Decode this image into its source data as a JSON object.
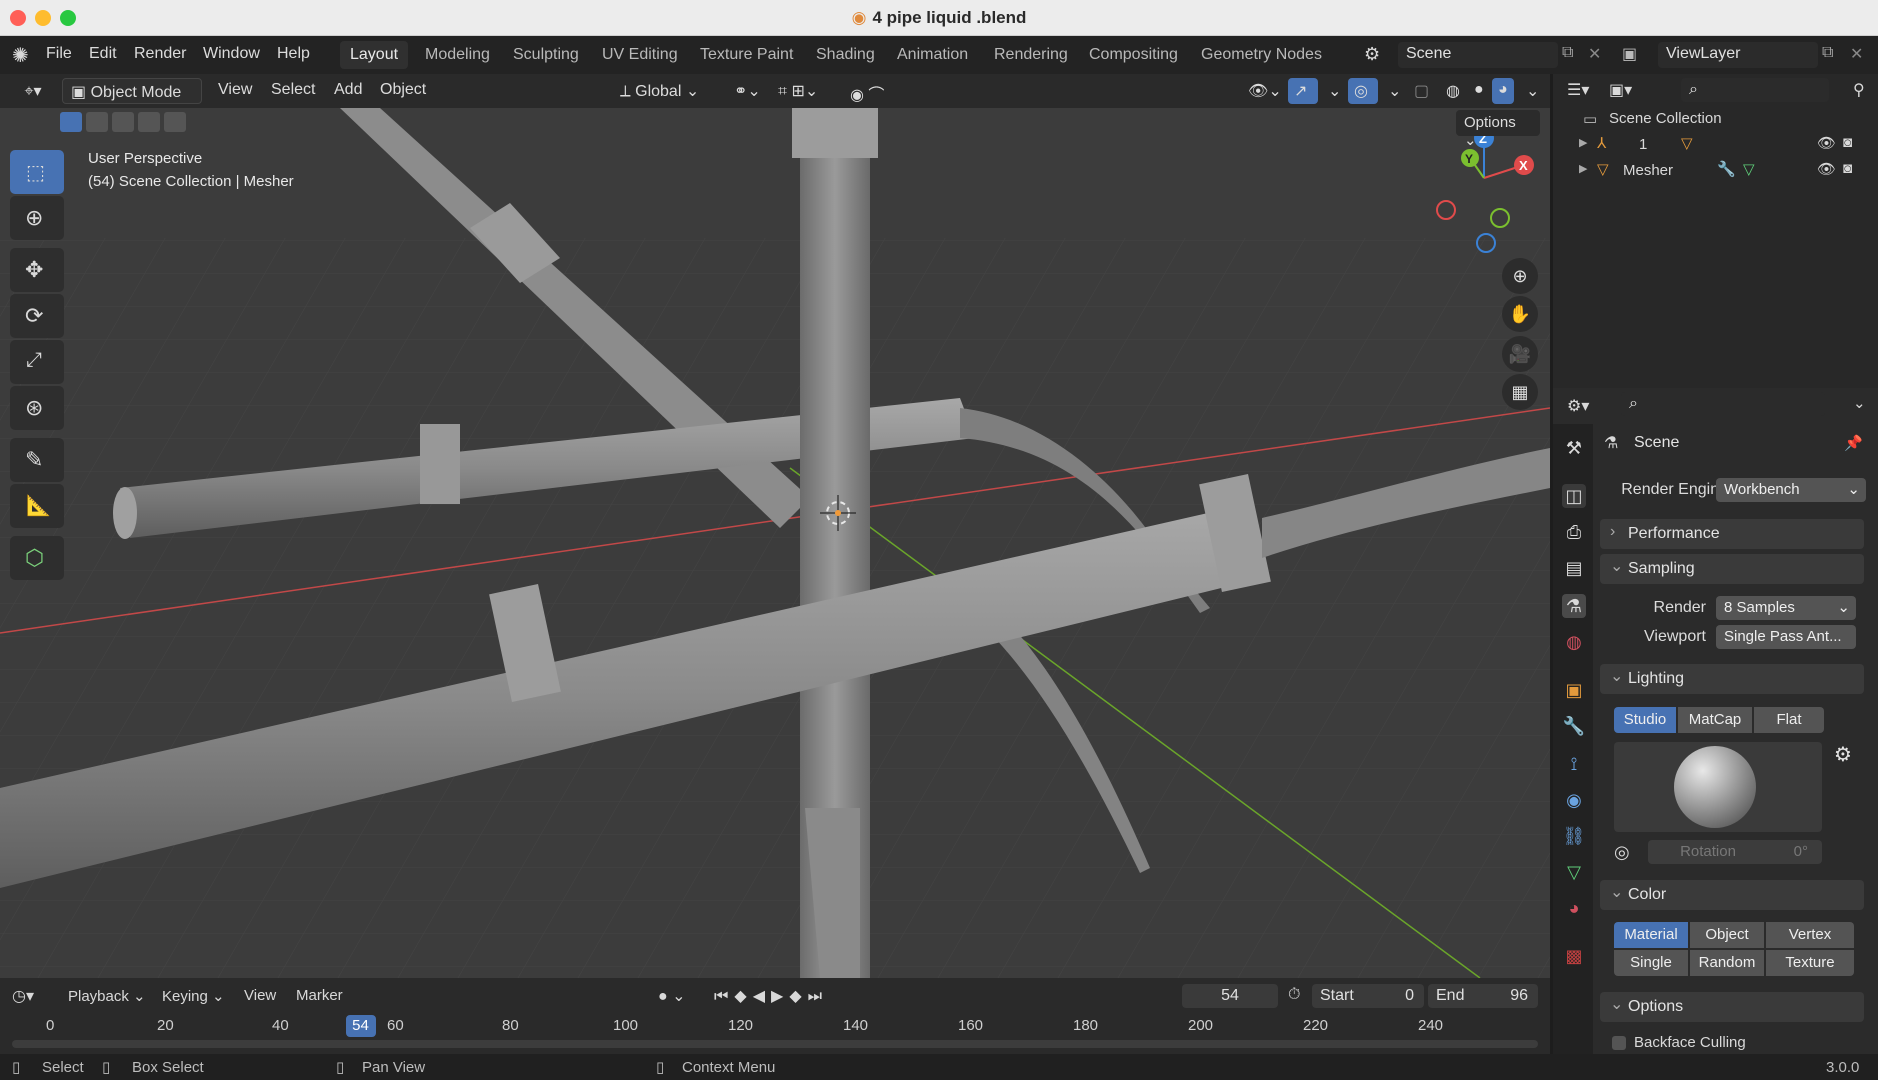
{
  "window": {
    "title": "4 pipe liquid .blend"
  },
  "menu": [
    "File",
    "Edit",
    "Render",
    "Window",
    "Help"
  ],
  "workspaces": [
    "Layout",
    "Modeling",
    "Sculpting",
    "UV Editing",
    "Texture Paint",
    "Shading",
    "Animation",
    "Rendering",
    "Compositing",
    "Geometry Nodes"
  ],
  "scene_field": "Scene",
  "viewlayer_field": "ViewLayer",
  "vp_header": {
    "mode": "Object Mode",
    "view": "View",
    "select": "Select",
    "add": "Add",
    "object": "Object",
    "orientation": "Global",
    "options": "Options"
  },
  "viewport": {
    "line1": "User Perspective",
    "line2": "(54) Scene Collection | Mesher"
  },
  "outliner": {
    "root": "Scene Collection",
    "items": [
      {
        "name": "1"
      },
      {
        "name": "Mesher"
      }
    ]
  },
  "props": {
    "title": "Scene",
    "render_engine_label": "Render Engine",
    "render_engine": "Workbench",
    "performance": "Performance",
    "sampling": "Sampling",
    "render_label": "Render",
    "render_value": "8 Samples",
    "viewport_label": "Viewport",
    "viewport_value": "Single Pass Ant...",
    "lighting": "Lighting",
    "lighting_modes": [
      "Studio",
      "MatCap",
      "Flat"
    ],
    "rotation_label": "Rotation",
    "rotation_value": "0°",
    "color": "Color",
    "color_modes": [
      "Material",
      "Object",
      "Vertex",
      "Single",
      "Random",
      "Texture"
    ],
    "options": "Options",
    "backface": "Backface Culling"
  },
  "timeline": {
    "playback": "Playback",
    "keying": "Keying",
    "view": "View",
    "marker": "Marker",
    "frame": "54",
    "start_label": "Start",
    "start": "0",
    "end_label": "End",
    "end": "96",
    "ticks": [
      "0",
      "20",
      "40",
      "60",
      "80",
      "100",
      "120",
      "140",
      "160",
      "180",
      "200",
      "220",
      "240"
    ],
    "current": "54",
    "current_fraction": 0.21
  },
  "status": {
    "select": "Select",
    "box_select": "Box Select",
    "pan_view": "Pan View",
    "context_menu": "Context Menu",
    "version": "3.0.0"
  },
  "colors": {
    "accent": "#4772b3",
    "x_axis": "#e04b4b",
    "y_axis": "#7bbf2f",
    "z_axis": "#3b82d6"
  }
}
